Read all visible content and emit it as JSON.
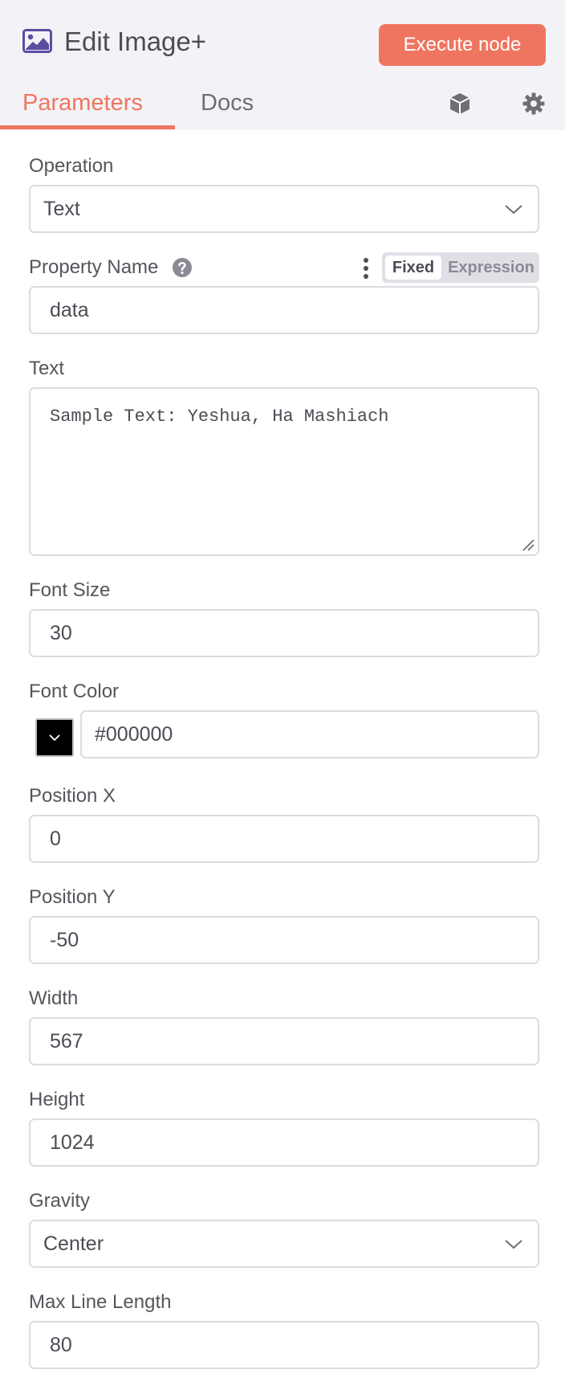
{
  "header": {
    "title": "Edit Image+",
    "execute_label": "Execute node",
    "tabs": [
      {
        "label": "Parameters",
        "active": true
      },
      {
        "label": "Docs",
        "active": false
      }
    ]
  },
  "colors": {
    "accent": "#f07560",
    "header_bg": "#f3f3f7",
    "icon_purple": "#5a4ea1",
    "swatch": "#000000"
  },
  "form": {
    "operation": {
      "label": "Operation",
      "value": "Text"
    },
    "property_name": {
      "label": "Property Name",
      "value": "data",
      "mode_fixed": "Fixed",
      "mode_expression": "Expression"
    },
    "text": {
      "label": "Text",
      "value": "Sample Text: Yeshua, Ha Mashiach"
    },
    "font_size": {
      "label": "Font Size",
      "value": "30"
    },
    "font_color": {
      "label": "Font Color",
      "value": "#000000"
    },
    "position_x": {
      "label": "Position X",
      "value": "0"
    },
    "position_y": {
      "label": "Position Y",
      "value": "-50"
    },
    "width": {
      "label": "Width",
      "value": "567"
    },
    "height": {
      "label": "Height",
      "value": "1024"
    },
    "gravity": {
      "label": "Gravity",
      "value": "Center"
    },
    "max_line_length": {
      "label": "Max Line Length",
      "value": "80"
    }
  },
  "icons": {
    "title": "image-icon",
    "cube": "cube-icon",
    "settings": "gear-icon",
    "help": "help-icon",
    "options": "more-vertical-icon",
    "dropdown": "chevron-down-icon"
  }
}
